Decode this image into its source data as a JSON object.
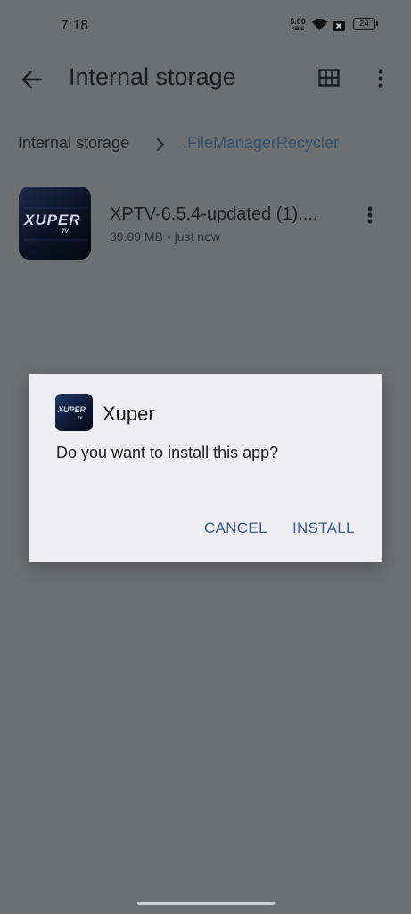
{
  "status_bar": {
    "time": "7:18",
    "net_speed_value": "5.00",
    "net_speed_unit": "KB/S",
    "battery": "24"
  },
  "app_bar": {
    "title": "Internal storage"
  },
  "breadcrumb": {
    "root": "Internal storage",
    "current": ".FileManagerRecycler"
  },
  "file": {
    "name": "XPTV-6.5.4-updated (1)....",
    "meta": "39.09 MB • just now",
    "logo_text": "XUPER",
    "logo_sub": "TV"
  },
  "dialog": {
    "app_name": "Xuper",
    "message": "Do you want to install this app?",
    "cancel_label": "CANCEL",
    "install_label": "INSTALL",
    "accent": "#3a5d8a"
  },
  "icons": {
    "back": "arrow-left-icon",
    "grid": "grid-view-icon",
    "more": "more-vertical-icon",
    "chevron": "chevron-right-icon",
    "wifi": "wifi-icon",
    "sim": "no-sim-icon",
    "battery": "battery-icon"
  }
}
